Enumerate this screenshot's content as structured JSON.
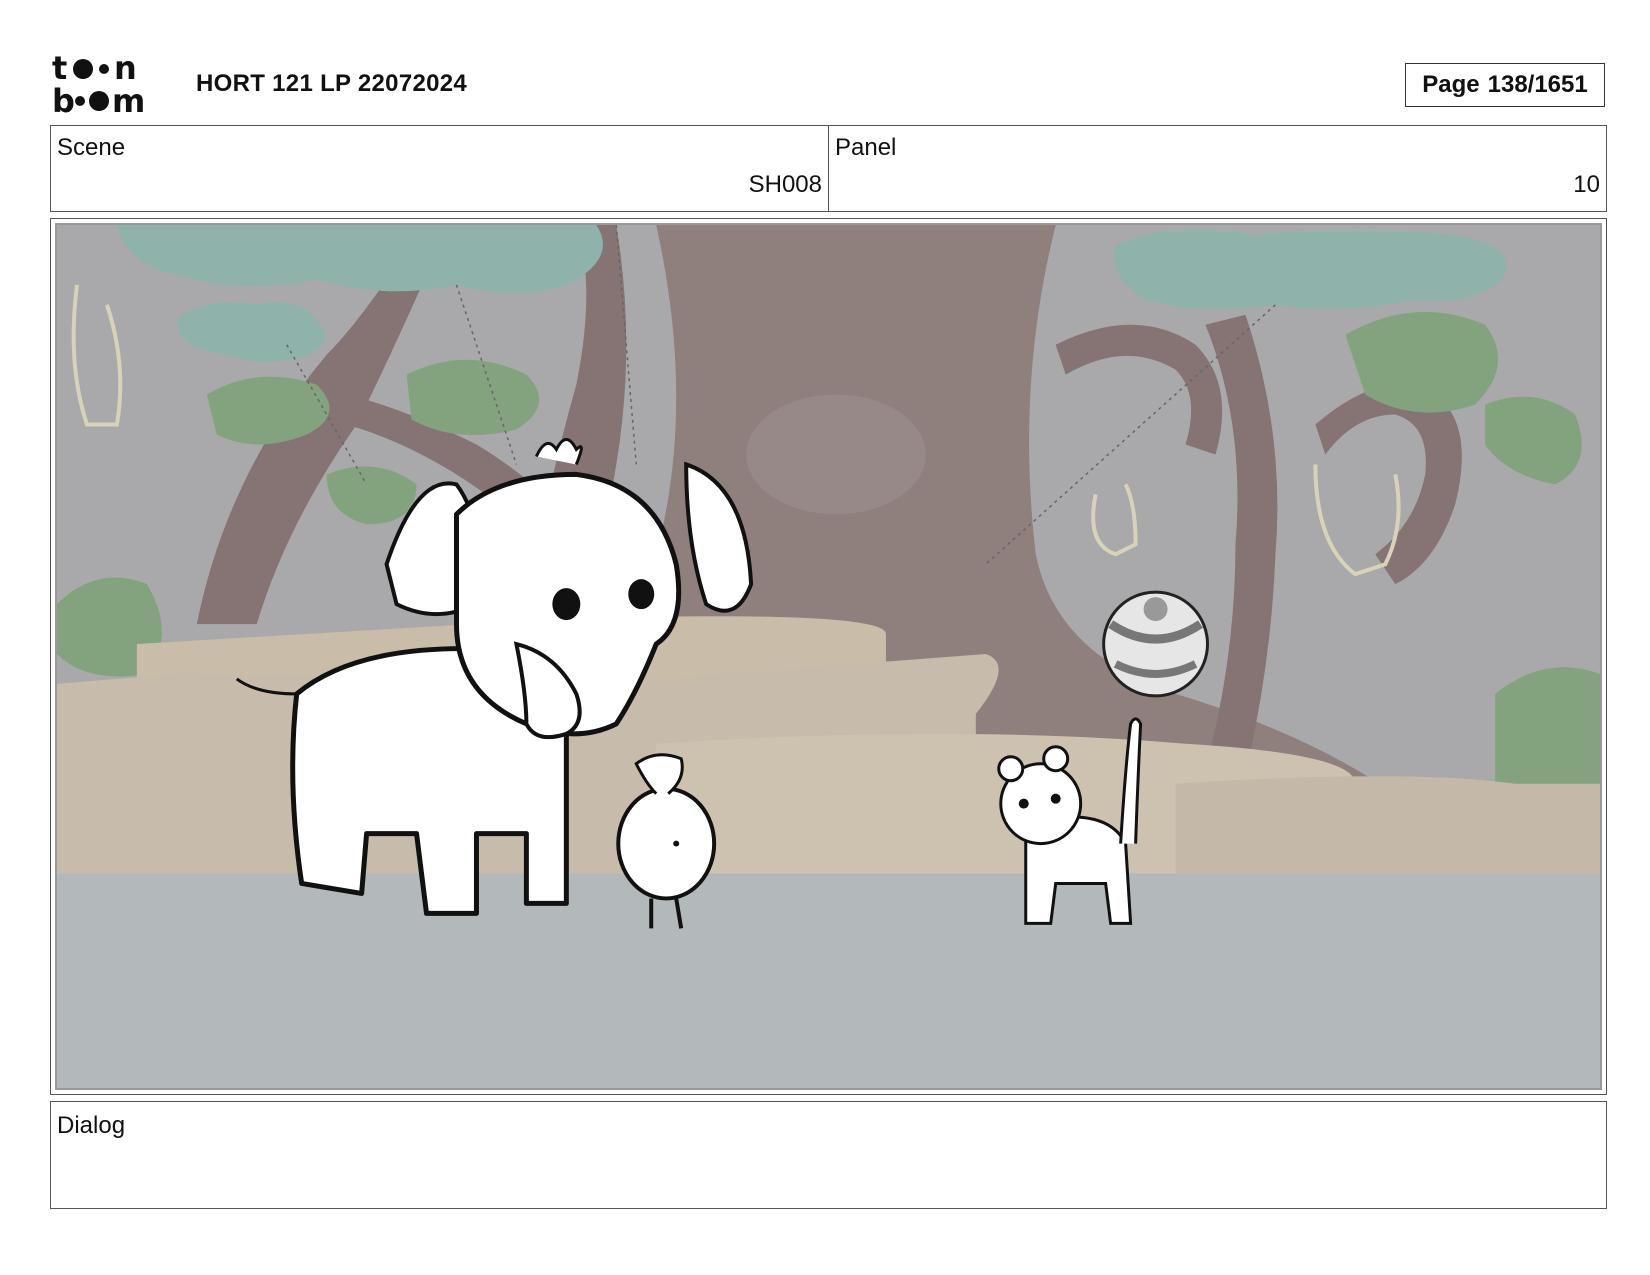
{
  "header": {
    "logo_text_top": "toon",
    "logo_text_bottom": "boom",
    "project_title": "HORT 121 LP 22072024",
    "page_label": "Page",
    "page_value": "138/1651"
  },
  "scene": {
    "label": "Scene",
    "value": "SH008"
  },
  "panel": {
    "label": "Panel",
    "value": "10"
  },
  "dialog": {
    "label": "Dialog",
    "value": ""
  },
  "artwork": {
    "background": "grey forest set with trees, rocks and hanging vines",
    "characters": [
      "elephant-icon",
      "sprout-bird-icon",
      "cat-icon"
    ],
    "props": [
      "ball-icon"
    ]
  }
}
